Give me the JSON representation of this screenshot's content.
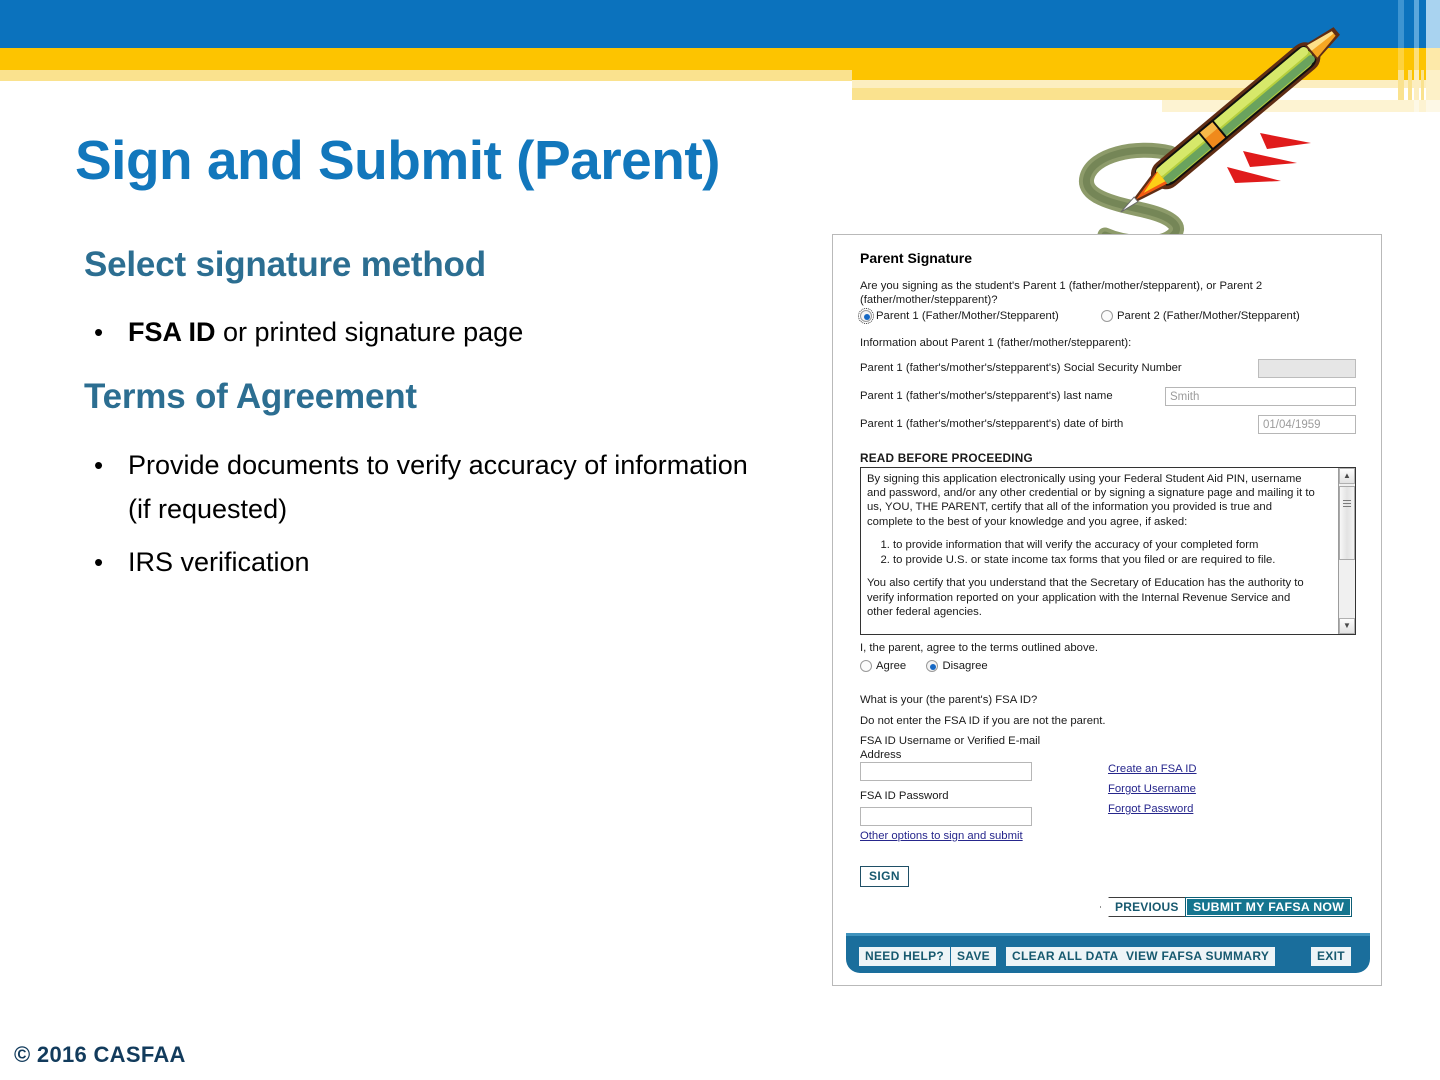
{
  "slide": {
    "title": "Sign and Submit (Parent)",
    "sections": [
      {
        "heading": "Select signature method"
      },
      {
        "heading": "Terms of Agreement"
      }
    ],
    "bullets": {
      "b1_strong": "FSA ID",
      "b1_rest": " or printed signature page",
      "b2": "Provide documents to verify accuracy of information (if requested)",
      "b3": "IRS verification"
    },
    "bullet_marker": "•",
    "copyright": "© 2016 CASFAA"
  },
  "colors": {
    "banner_blue": "#0b72bd",
    "banner_yellow": "#fdc400",
    "title_blue": "#1277bc",
    "heading_teal": "#2c6e91",
    "fafsa_blue": "#1a6e9c",
    "fafsa_teal": "#15758f",
    "link_navy": "#26268c"
  },
  "fafsa": {
    "section_title": "Parent Signature",
    "question": "Are you signing as the student's Parent 1 (father/mother/stepparent), or Parent 2 (father/mother/stepparent)?",
    "parent_options": [
      {
        "label": "Parent 1 (Father/Mother/Stepparent)",
        "selected": true
      },
      {
        "label": "Parent 2 (Father/Mother/Stepparent)",
        "selected": false
      }
    ],
    "info_line": "Information about Parent 1 (father/mother/stepparent):",
    "fields": [
      {
        "label": "Parent 1 (father's/mother's/stepparent's) Social Security Number",
        "value": "",
        "state": "disabled"
      },
      {
        "label": "Parent 1 (father's/mother's/stepparent's) last name",
        "value": "Smith",
        "state": "filled"
      },
      {
        "label": "Parent 1 (father's/mother's/stepparent's) date of birth",
        "value": "01/04/1959",
        "state": "filled"
      }
    ],
    "read_before": {
      "title": "READ BEFORE PROCEEDING",
      "para1": "By signing this application electronically using your Federal Student Aid PIN, username and password, and/or any other credential or by signing a signature page and mailing it to us, YOU, THE PARENT, certify that all of the information you provided is true and complete to the best of your knowledge and you agree, if asked:",
      "items": [
        "to provide information that will verify the accuracy of your completed form",
        "to provide U.S. or state income tax forms that you filed or are required to file."
      ],
      "para2": "You also certify that you understand that the Secretary of Education has the authority to verify information reported on your application with the Internal Revenue Service and other federal agencies."
    },
    "agree_prompt": "I, the parent, agree to the terms outlined above.",
    "agree_options": [
      {
        "label": "Agree",
        "selected": false
      },
      {
        "label": "Disagree",
        "selected": true
      }
    ],
    "fsa_question": "What is your (the parent's) FSA ID?",
    "fsa_note": "Do not enter the FSA ID if you are not the parent.",
    "username_label": "FSA ID Username or Verified E-mail Address",
    "username_value": "",
    "password_label": "FSA ID Password",
    "password_value": "",
    "other_options_link": "Other options to sign and submit",
    "side_links": [
      "Create an FSA ID",
      "Forgot Username",
      "Forgot Password"
    ],
    "sign_button": "SIGN",
    "previous_button": "PREVIOUS",
    "submit_button": "SUBMIT MY FAFSA NOW",
    "toolbar_buttons": [
      "NEED HELP?",
      "SAVE",
      "CLEAR ALL DATA",
      "VIEW FAFSA SUMMARY",
      "EXIT"
    ],
    "scrollbar": {
      "up_arrow": "▲",
      "down_arrow": "▼"
    }
  }
}
